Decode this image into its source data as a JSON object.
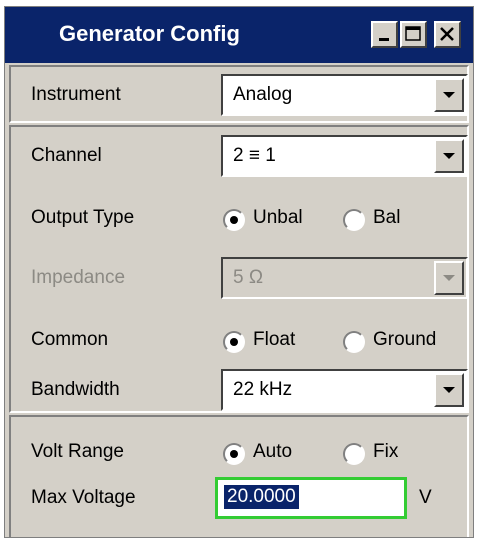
{
  "window": {
    "title": "Generator Config",
    "title_bar_color": "#0a246a",
    "background": "#d4d0c8",
    "controls": [
      "minimize-icon",
      "maximize-icon",
      "close-icon"
    ]
  },
  "instrument": {
    "label": "Instrument",
    "value": "Analog"
  },
  "channel": {
    "label": "Channel",
    "value": "2 ≡ 1"
  },
  "output_type": {
    "label": "Output Type",
    "options": [
      "Unbal",
      "Bal"
    ],
    "selected": "Unbal"
  },
  "impedance": {
    "label": "Impedance",
    "value": "5 Ω",
    "enabled": false
  },
  "common": {
    "label": "Common",
    "options": [
      "Float",
      "Ground"
    ],
    "selected": "Float"
  },
  "bandwidth": {
    "label": "Bandwidth",
    "value": "22 kHz"
  },
  "volt_range": {
    "label": "Volt Range",
    "options": [
      "Auto",
      "Fix"
    ],
    "selected": "Auto"
  },
  "max_voltage": {
    "label": "Max Voltage",
    "value": "20.0000",
    "unit": "V",
    "focus_color": "#33cc33"
  }
}
